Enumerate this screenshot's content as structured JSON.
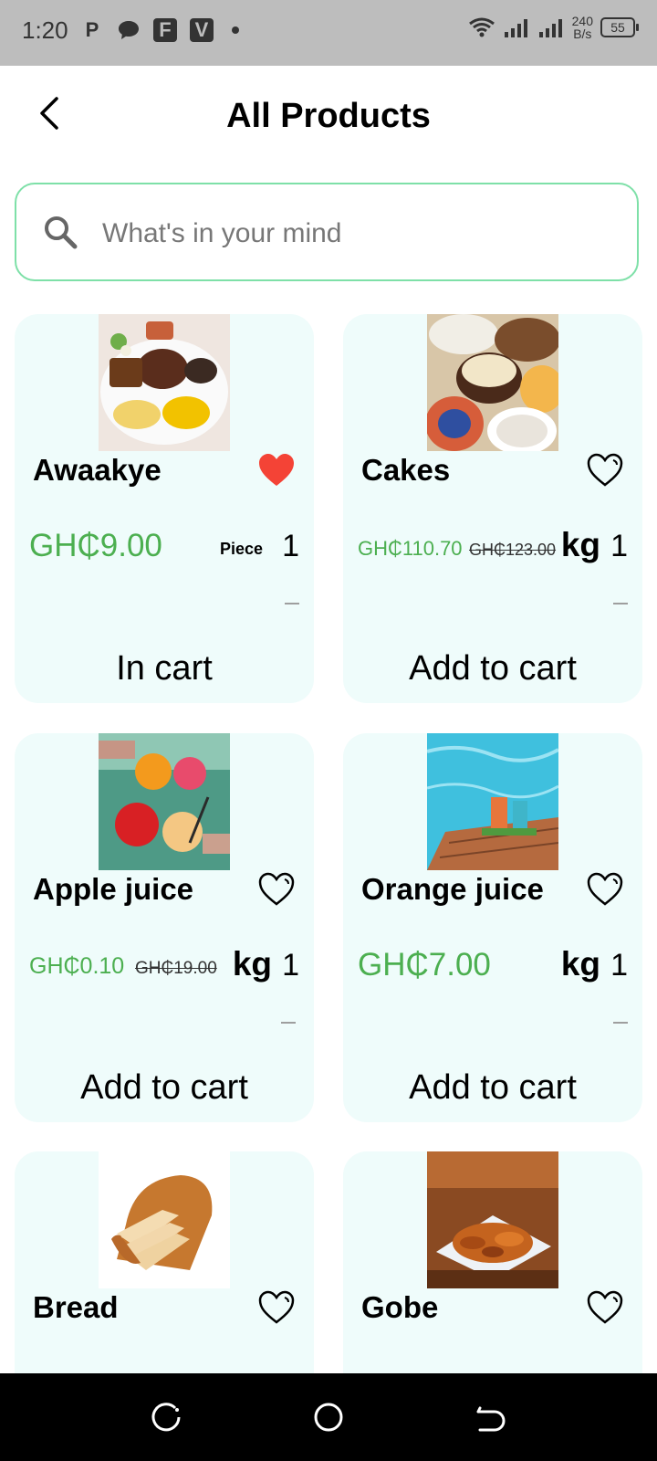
{
  "status_bar": {
    "time": "1:20",
    "app_icons": [
      "P",
      "chat-icon",
      "F",
      "V"
    ],
    "net_speed_top": "240",
    "net_speed_bottom": "B/s",
    "battery": "55"
  },
  "header": {
    "title": "All Products"
  },
  "search": {
    "placeholder": "What's in your mind"
  },
  "colors": {
    "accent": "#4caf50",
    "search_border": "#7ee0a8",
    "card_bg": "#effcfb",
    "heart_active": "#f44336"
  },
  "products": [
    {
      "name": "Awaakye",
      "price": "GH₵9.00",
      "old_price": "",
      "unit": "Piece",
      "qty": "1",
      "cart_label": "In cart",
      "favorite": true
    },
    {
      "name": "Cakes",
      "price": "GH₵110.70",
      "old_price": "GH₵123.00",
      "unit": "kg",
      "qty": "1",
      "cart_label": "Add to cart",
      "favorite": false
    },
    {
      "name": "Apple juice",
      "price": "GH₵0.10",
      "old_price": "GH₵19.00",
      "unit": "kg",
      "qty": "1",
      "cart_label": "Add to cart",
      "favorite": false
    },
    {
      "name": "Orange juice",
      "price": "GH₵7.00",
      "old_price": "",
      "unit": "kg",
      "qty": "1",
      "cart_label": "Add to cart",
      "favorite": false
    },
    {
      "name": "Bread",
      "favorite": false
    },
    {
      "name": "Gobe",
      "favorite": false
    }
  ]
}
